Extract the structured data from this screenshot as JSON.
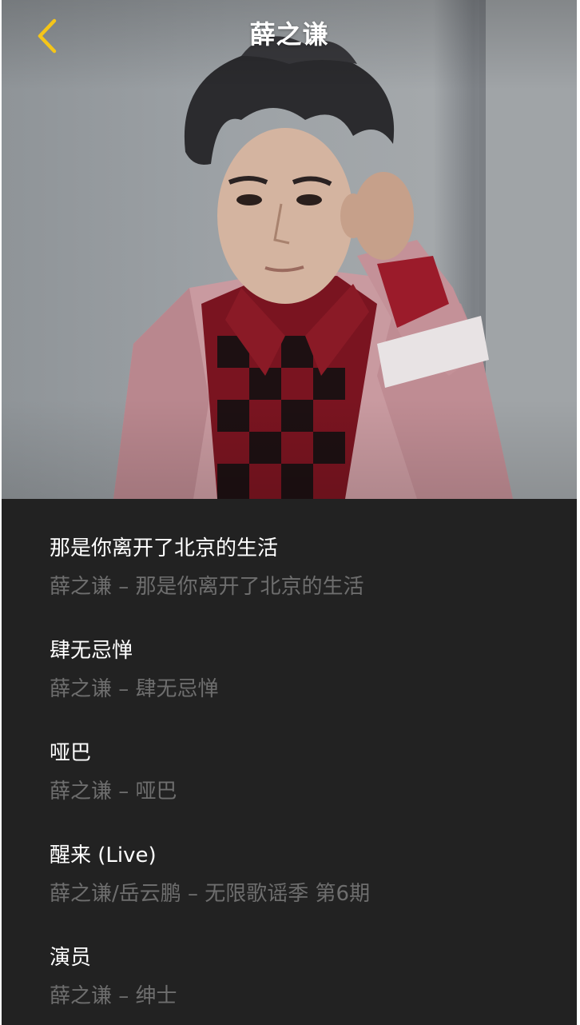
{
  "header": {
    "title": "薛之谦",
    "back_icon": "chevron-left-icon",
    "accent_color": "#f5c518"
  },
  "hero": {
    "image": "artist-portrait"
  },
  "songs": [
    {
      "title": "那是你离开了北京的生活",
      "subtitle": "薛之谦 – 那是你离开了北京的生活"
    },
    {
      "title": "肆无忌惮",
      "subtitle": "薛之谦 – 肆无忌惮"
    },
    {
      "title": "哑巴",
      "subtitle": "薛之谦 – 哑巴"
    },
    {
      "title": "醒来 (Live)",
      "subtitle": "薛之谦/岳云鹏 – 无限歌谣季 第6期"
    },
    {
      "title": "演员",
      "subtitle": "薛之谦 – 绅士"
    }
  ],
  "colors": {
    "background": "#222222",
    "title_text": "#ffffff",
    "subtitle_text": "#6e6e6e"
  }
}
